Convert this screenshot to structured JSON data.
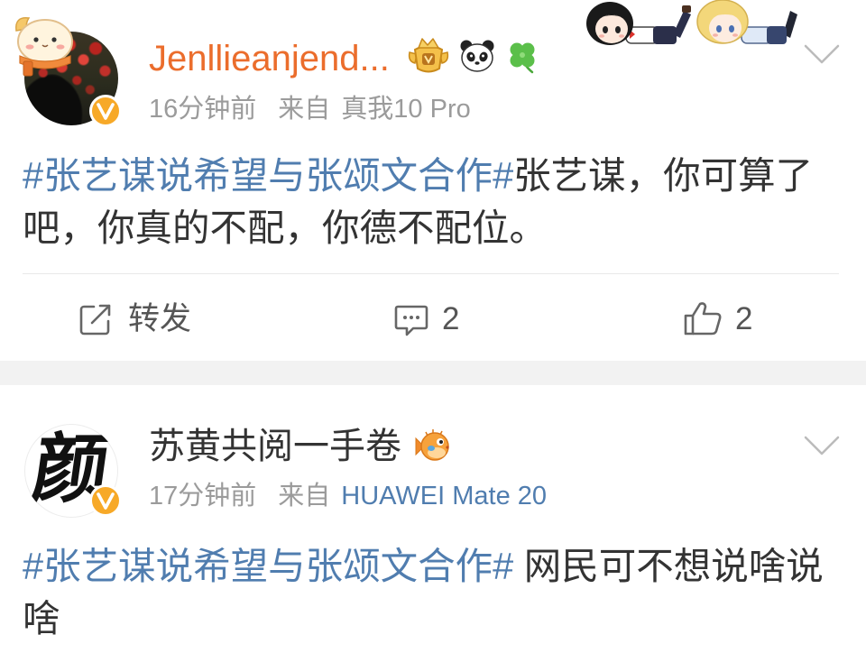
{
  "colors": {
    "hashtag": "#507daf",
    "vip_username": "#eb6d2c",
    "meta": "#9b9b9b",
    "text": "#333333",
    "source_link": "#507daf",
    "verified": "#f7a928",
    "separator": "#f2f2f2"
  },
  "posts": [
    {
      "verified": true,
      "username": "Jenllieanjend...",
      "badges": [
        "vip-crown-icon",
        "panda-icon",
        "clover-icon"
      ],
      "time": "16分钟前",
      "source_prefix": "来自",
      "source": "真我10 Pro",
      "hashtag": "#张艺谋说希望与张颂文合作#",
      "text": "张艺谋，你可算了吧，你真的不配，你德不配位。",
      "actions": {
        "repost_label": "转发",
        "comment_count": "2",
        "like_count": "2"
      }
    },
    {
      "avatar_glyph": "颜",
      "verified": true,
      "username": "苏黄共阅一手卷",
      "badges": [
        "pufferfish-icon"
      ],
      "time": "17分钟前",
      "source_prefix": "来自",
      "source": "HUAWEI Mate 20",
      "hashtag": "#张艺谋说希望与张颂文合作#",
      "text": " 网民可不想说啥说啥"
    }
  ],
  "icons": {
    "more": "chevron-down-icon",
    "repost": "share-icon",
    "comment": "comment-icon",
    "like": "thumbs-up-icon"
  }
}
